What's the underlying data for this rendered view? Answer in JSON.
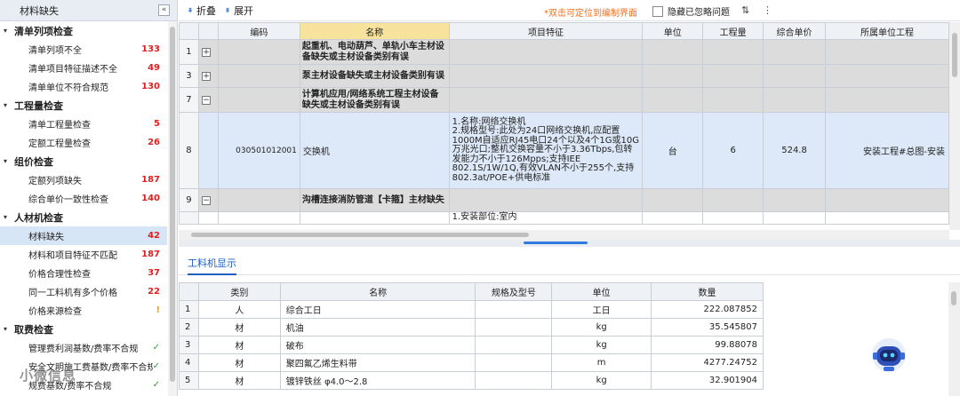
{
  "sidebar": {
    "title": "材料缺失",
    "collapse_icon": "«",
    "groups": [
      {
        "label": "清单列项检查",
        "items": [
          {
            "label": "清单列项不全",
            "count": "133",
            "kind": "red"
          },
          {
            "label": "清单项目特征描述不全",
            "count": "49",
            "kind": "red"
          },
          {
            "label": "清单单位不符合规范",
            "count": "130",
            "kind": "red"
          }
        ]
      },
      {
        "label": "工程量检查",
        "items": [
          {
            "label": "清单工程量检查",
            "count": "5",
            "kind": "red"
          },
          {
            "label": "定额工程量检查",
            "count": "26",
            "kind": "red"
          }
        ]
      },
      {
        "label": "组价检查",
        "items": [
          {
            "label": "定额列项缺失",
            "count": "187",
            "kind": "red"
          },
          {
            "label": "综合单价一致性检查",
            "count": "140",
            "kind": "red"
          }
        ]
      },
      {
        "label": "人材机检查",
        "items": [
          {
            "label": "材料缺失",
            "count": "42",
            "kind": "red",
            "selected": true
          },
          {
            "label": "材料和项目特征不匹配",
            "count": "187",
            "kind": "red"
          },
          {
            "label": "价格合理性检查",
            "count": "37",
            "kind": "red"
          },
          {
            "label": "同一工料机有多个价格",
            "count": "22",
            "kind": "red"
          },
          {
            "label": "价格来源检查",
            "count": "!",
            "kind": "warn"
          }
        ]
      },
      {
        "label": "取费检查",
        "items": [
          {
            "label": "管理费利润基数/费率不合规",
            "count": "✓",
            "kind": "ok"
          },
          {
            "label": "安全文明施工费基数/费率不合规",
            "count": "✓",
            "kind": "ok"
          },
          {
            "label": "规费基数/费率不合规",
            "count": "✓",
            "kind": "ok"
          }
        ]
      }
    ],
    "watermark": "小微信息"
  },
  "toolbar": {
    "collapse_label": "折叠",
    "expand_label": "展开",
    "hint": "*双击可定位到编制界面",
    "hide_label": "隐藏已忽略问题"
  },
  "grid": {
    "headers": [
      "",
      "",
      "编码",
      "名称",
      "项目特征",
      "单位",
      "工程量",
      "综合单价",
      "所属单位工程"
    ],
    "rows": [
      {
        "no": "1",
        "toggle": "+",
        "code": "",
        "name": "起重机、电动葫芦、单轨小车主材设备缺失或主材设备类别有误",
        "feature": "",
        "unit": "",
        "qty": "",
        "price": "",
        "project": "",
        "style": "gray"
      },
      {
        "no": "3",
        "toggle": "+",
        "code": "",
        "name": "泵主材设备缺失或主材设备类别有误",
        "feature": "",
        "unit": "",
        "qty": "",
        "price": "",
        "project": "",
        "style": "gray"
      },
      {
        "no": "7",
        "toggle": "−",
        "code": "",
        "name": "计算机应用/网络系统工程主材设备缺失或主材设备类别有误",
        "feature": "",
        "unit": "",
        "qty": "",
        "price": "",
        "project": "",
        "style": "gray"
      },
      {
        "no": "8",
        "toggle": "",
        "code": "030501012001",
        "name": "交换机",
        "feature": "1.名称:网络交换机\n2.规格型号:此处为24口网络交换机,应配置1000M自适应RJ45电口24个以及4个1G或10G万兆光口;整机交换容量不小于3.36Tbps,包转发能力不小于126Mpps;支持IEE 802.1S/1W/1Q,有效VLAN不小于255个,支持802.3at/POE+供电标准",
        "unit": "台",
        "qty": "6",
        "price": "524.8",
        "project": "安装工程#总图-安装",
        "style": "blue"
      },
      {
        "no": "9",
        "toggle": "−",
        "code": "",
        "name": "沟槽连接消防管道【卡箍】主材缺失",
        "feature": "",
        "unit": "",
        "qty": "",
        "price": "",
        "project": "",
        "style": "gray"
      },
      {
        "no": "",
        "toggle": "",
        "code": "",
        "name": "",
        "feature": "1.安装部位:室内",
        "unit": "",
        "qty": "",
        "price": "",
        "project": "",
        "style": "sel"
      }
    ]
  },
  "lower": {
    "tab_label": "工料机显示",
    "headers": [
      "",
      "类别",
      "名称",
      "规格及型号",
      "单位",
      "数量"
    ],
    "rows": [
      {
        "no": "1",
        "cat": "人",
        "name": "综合工日",
        "spec": "",
        "unit": "工日",
        "qty": "222.087852"
      },
      {
        "no": "2",
        "cat": "材",
        "name": "机油",
        "spec": "",
        "unit": "kg",
        "qty": "35.545807"
      },
      {
        "no": "3",
        "cat": "材",
        "name": "破布",
        "spec": "",
        "unit": "kg",
        "qty": "99.88078"
      },
      {
        "no": "4",
        "cat": "材",
        "name": "聚四氟乙烯生料带",
        "spec": "",
        "unit": "m",
        "qty": "4277.24752"
      },
      {
        "no": "5",
        "cat": "材",
        "name": "镀锌铁丝  φ4.0～2.8",
        "spec": "",
        "unit": "kg",
        "qty": "32.901904"
      }
    ]
  },
  "colors": {
    "accent": "#2f7be0",
    "alert": "#e02020",
    "hint": "#f07020"
  }
}
